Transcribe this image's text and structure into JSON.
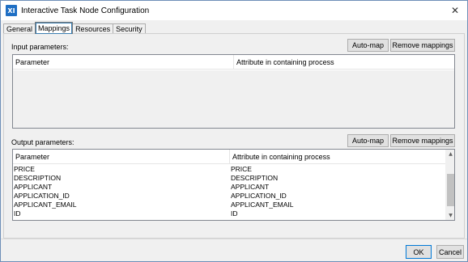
{
  "window": {
    "title": "Interactive Task Node Configuration",
    "app_icon_text": "XI",
    "close_glyph": "✕"
  },
  "tabs": [
    {
      "label": "General",
      "active": false
    },
    {
      "label": "Mappings",
      "active": true
    },
    {
      "label": "Resources",
      "active": false
    },
    {
      "label": "Security",
      "active": false
    }
  ],
  "input_section": {
    "label": "Input parameters:",
    "auto_map_label": "Auto-map",
    "remove_label": "Remove mappings",
    "columns": [
      "Parameter",
      "Attribute in containing process"
    ],
    "rows": []
  },
  "output_section": {
    "label": "Output parameters:",
    "auto_map_label": "Auto-map",
    "remove_label": "Remove mappings",
    "columns": [
      "Parameter",
      "Attribute in containing process"
    ],
    "rows": [
      [
        "PRICE",
        "PRICE"
      ],
      [
        "DESCRIPTION",
        "DESCRIPTION"
      ],
      [
        "APPLICANT",
        "APPLICANT"
      ],
      [
        "APPLICATION_ID",
        "APPLICATION_ID"
      ],
      [
        "APPLICANT_EMAIL",
        "APPLICANT_EMAIL"
      ],
      [
        "ID",
        "ID"
      ]
    ]
  },
  "footer": {
    "ok_label": "OK",
    "cancel_label": "Cancel"
  }
}
